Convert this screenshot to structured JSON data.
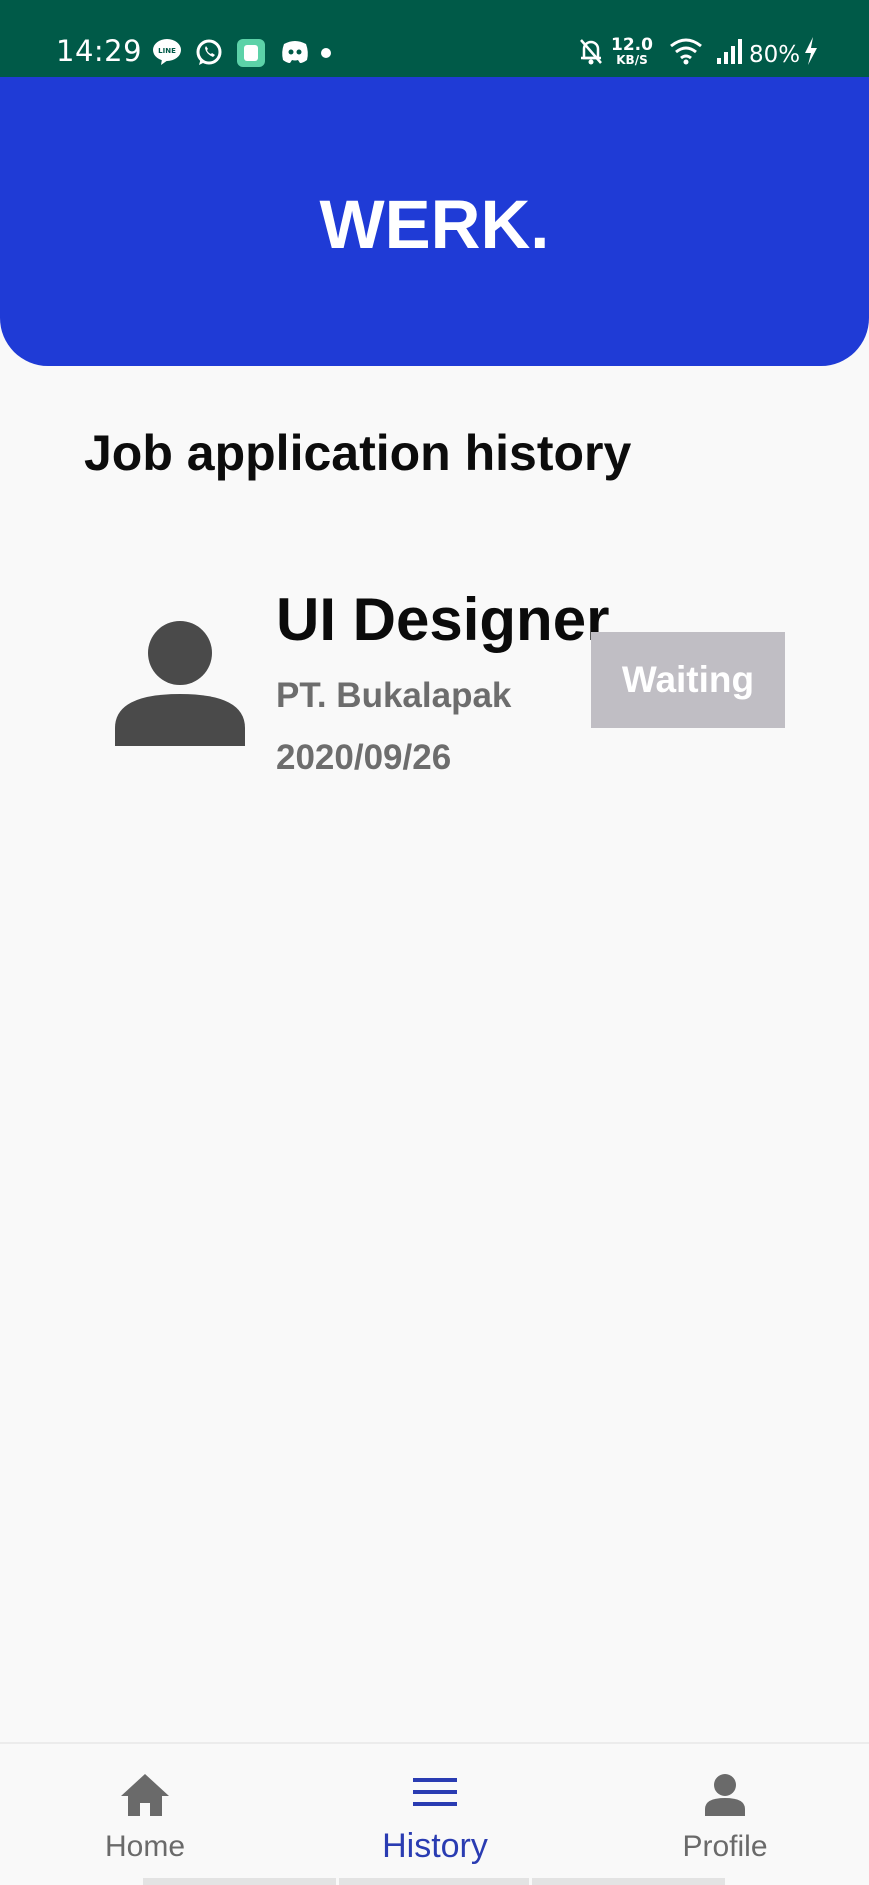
{
  "status_bar": {
    "time": "14:29",
    "notification_icons": [
      "line-icon",
      "whatsapp-icon",
      "app-icon",
      "discord-icon",
      "more-dot-icon"
    ],
    "net_speed_value": "12.0",
    "net_speed_unit": "KB/S",
    "battery": "80%",
    "system_icons": [
      "bell-muted-icon",
      "wifi-icon",
      "signal-icon",
      "charging-icon"
    ]
  },
  "header": {
    "brand": "WERK."
  },
  "page": {
    "title": "Job application history"
  },
  "applications": [
    {
      "title": "UI Designer",
      "company": "PT. Bukalapak",
      "date": "2020/09/26",
      "status": "Waiting",
      "avatar_icon": "person-icon"
    }
  ],
  "bottom_nav": {
    "active": "History",
    "items": [
      {
        "label": "Home",
        "icon": "home-icon"
      },
      {
        "label": "History",
        "icon": "menu-icon"
      },
      {
        "label": "Profile",
        "icon": "person-icon"
      }
    ]
  },
  "colors": {
    "status_bar": "#005a48",
    "brand_blue": "#1f3bd6",
    "badge_grey": "#c0bec4",
    "nav_active": "#2a3cb2"
  }
}
